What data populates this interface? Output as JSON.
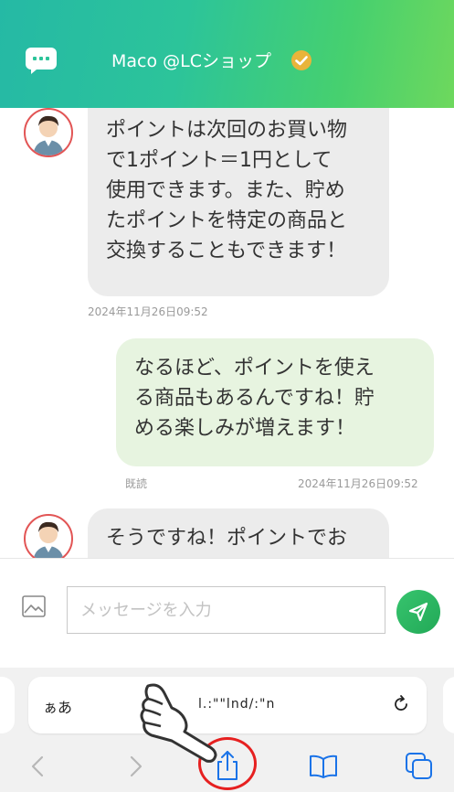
{
  "header": {
    "title": "Maco @LCショップ",
    "icon": "chat-bubble-icon",
    "verified_icon": "verified-check-icon",
    "accent": "#2cc49a"
  },
  "messages": [
    {
      "side": "in",
      "lines": [
        "ポイントは次回のお買い物",
        "で1ポイント＝1円として",
        "使用できます。また、貯め",
        "たポイントを特定の商品と",
        "交換することもできます！"
      ],
      "timestamp": "2024年11月26日09:52"
    },
    {
      "side": "out",
      "lines": [
        "なるほど、ポイントを使え",
        "る商品もあるんですね！貯",
        "める楽しみが増えます！"
      ],
      "read_label": "既読",
      "timestamp": "2024年11月26日09:52"
    },
    {
      "side": "in",
      "lines": [
        "そうですね！ポイントでお"
      ]
    }
  ],
  "input": {
    "placeholder": "メッセージを入力",
    "value": "",
    "image_icon": "image-icon",
    "send_icon": "send-icon",
    "send_color": "#2fb864"
  },
  "browser": {
    "aa_label": "ぁあ",
    "url": "l.:\"\"lnd/:\"n",
    "reload_icon": "reload-icon",
    "toolbar": [
      "back-icon",
      "forward-icon",
      "share-icon",
      "bookmarks-icon",
      "tabs-icon"
    ],
    "link_color": "#1a73e8",
    "highlight_color": "#e62020"
  }
}
